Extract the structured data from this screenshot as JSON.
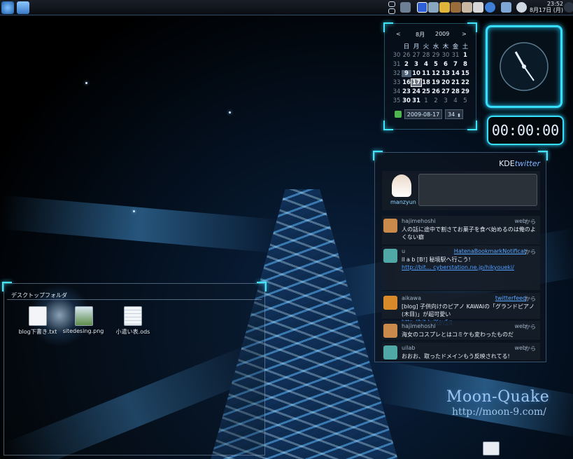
{
  "taskbar": {
    "clock_time": "23:52",
    "clock_date": "8月17日 (月)"
  },
  "calendar": {
    "prev": "<",
    "next": ">",
    "month": "8月",
    "year": "2009",
    "weekdays": [
      "日",
      "月",
      "火",
      "水",
      "木",
      "金",
      "土"
    ],
    "weeks": [
      {
        "num": "30",
        "days": [
          "26",
          "27",
          "28",
          "29",
          "30",
          "31",
          "1"
        ]
      },
      {
        "num": "31",
        "days": [
          "2",
          "3",
          "4",
          "5",
          "6",
          "7",
          "8"
        ]
      },
      {
        "num": "32",
        "days": [
          "9",
          "10",
          "11",
          "12",
          "13",
          "14",
          "15"
        ]
      },
      {
        "num": "33",
        "days": [
          "16",
          "17",
          "18",
          "19",
          "20",
          "21",
          "22"
        ]
      },
      {
        "num": "34",
        "days": [
          "23",
          "24",
          "25",
          "26",
          "27",
          "28",
          "29"
        ]
      },
      {
        "num": "35",
        "days": [
          "30",
          "31",
          "1",
          "2",
          "3",
          "4",
          "5"
        ]
      }
    ],
    "date_field": "2009-08-17",
    "week_field": "34"
  },
  "timer": {
    "value": "00:00:00"
  },
  "twitter": {
    "brand_prefix": "KDE",
    "brand_suffix": "twitter",
    "username": "manzyun",
    "tweets": [
      {
        "user": "hajimehoshi",
        "source": "web",
        "suffix": "から",
        "body": "人の話に途中で割さてお菓子を食べ始めるのは俺のよくない癖",
        "link": ""
      },
      {
        "user": "u",
        "source": "HatenaBookmarkNotificat",
        "suffix": "から",
        "body": "ll a b [B!] 秘境駅へ行こう!",
        "link": "http://bit... cyberstation.ne.jp/hikyoueki/"
      },
      {
        "user": "aikawa",
        "source": "twitterfeed",
        "suffix": "から",
        "body": "[blog] 子供向けのピアノ KAWAIの「グランドピアノ(木目)」が超可愛い",
        "link": "http://bit.ly/Xay5g"
      },
      {
        "user": "hajimehoshi",
        "source": "web",
        "suffix": "から",
        "body": "海女のコスプレとはコミケも変わったものだ",
        "link": ""
      },
      {
        "user": "uilab",
        "source": "web",
        "suffix": "から",
        "body": "おおお、取ったドメインもう反映されてる!",
        "link": ""
      }
    ]
  },
  "folder": {
    "title": "デスクトップフォルダ",
    "files": [
      {
        "name": "blog下書き.txt",
        "icon": "text-file-icon"
      },
      {
        "name": "sitedesing.png",
        "icon": "image-file-icon"
      },
      {
        "name": "小遣い表.ods",
        "icon": "spreadsheet-file-icon"
      }
    ]
  },
  "watermark": {
    "title": "Moon-Quake",
    "url": "http://moon-9.com/"
  },
  "colors": {
    "accent": "#3fe6ff",
    "link": "#4e9dff"
  }
}
